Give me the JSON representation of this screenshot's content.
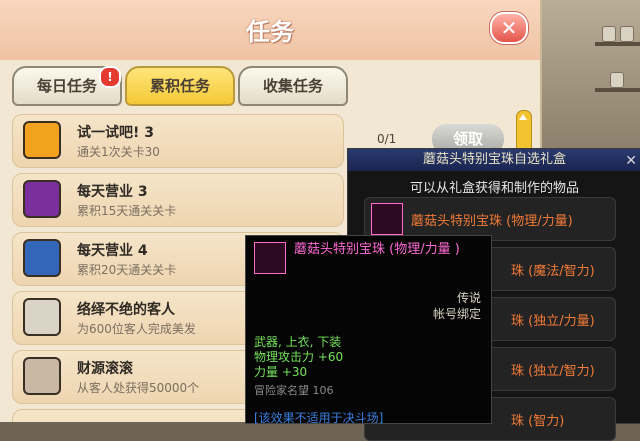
{
  "window": {
    "title": "任务",
    "close_symbol": "✕"
  },
  "tabs": [
    {
      "label": "每日任务",
      "badge": "!"
    },
    {
      "label": "累积任务",
      "active": true
    },
    {
      "label": "收集任务"
    }
  ],
  "quests": [
    {
      "title": "试一试吧! 3",
      "desc": "通关1次关卡30",
      "icon": "quest-icon-9"
    },
    {
      "title": "每天营业 3",
      "desc": "累积15天通关关卡",
      "icon": "quest-icon-shop"
    },
    {
      "title": "每天营业 4",
      "desc": "累积20天通关关卡",
      "icon": "quest-icon-shop"
    },
    {
      "title": "络绎不绝的客人",
      "desc": "为600位客人完成美发",
      "icon": "quest-icon-customer"
    },
    {
      "title": "财源滚滚",
      "desc": "从客人处获得50000个",
      "icon": "quest-icon-customer"
    }
  ],
  "first_quest_progress": "0/1",
  "claim_label": "领取",
  "gift_box": {
    "title": "蘑菇头特别宝珠自选礼盒",
    "close_symbol": "✕",
    "subtitle": "可以从礼盒获得和制作的物品",
    "items": [
      "蘑菇头特别宝珠 (物理/力量)",
      "珠 (魔法/智力)",
      "珠 (独立/力量)",
      "珠 (独立/智力)",
      "珠 (智力)"
    ]
  },
  "tooltip": {
    "name": "蘑菇头特别宝珠 (物理/力量 )",
    "rarity": "传说",
    "bind": "帐号绑定",
    "slots": "武器, 上衣, 下装",
    "stat1": "物理攻击力 +60",
    "stat2": "力量 +30",
    "level_req": "冒险家名望 106",
    "note": "[该效果不适用于决斗场]"
  },
  "colors": {
    "accent": "#f4c937",
    "item_name": "#f07a37",
    "tooltip_name": "#ff6ad4",
    "stat_green": "#75e35b"
  }
}
